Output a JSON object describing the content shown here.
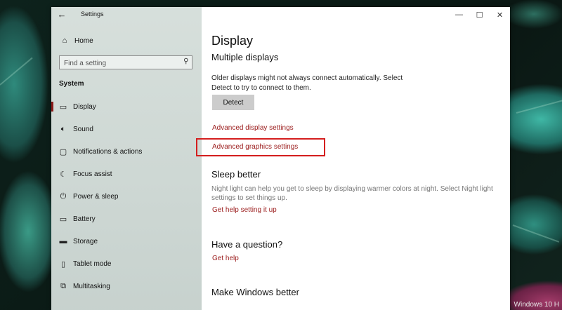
{
  "window": {
    "title": "Settings",
    "controls": {
      "minimize": "—",
      "maximize": "☐",
      "close": "✕"
    }
  },
  "sidebar": {
    "home_label": "Home",
    "search": {
      "placeholder": "Find a setting",
      "value": ""
    },
    "section_label": "System",
    "items": [
      {
        "label": "Display",
        "icon": "monitor-icon",
        "selected": true
      },
      {
        "label": "Sound",
        "icon": "speaker-icon"
      },
      {
        "label": "Notifications & actions",
        "icon": "notification-icon"
      },
      {
        "label": "Focus assist",
        "icon": "moon-icon"
      },
      {
        "label": "Power & sleep",
        "icon": "power-icon"
      },
      {
        "label": "Battery",
        "icon": "battery-icon"
      },
      {
        "label": "Storage",
        "icon": "storage-icon"
      },
      {
        "label": "Tablet mode",
        "icon": "tablet-icon"
      },
      {
        "label": "Multitasking",
        "icon": "multitasking-icon"
      }
    ]
  },
  "content": {
    "page_title": "Display",
    "multiple_displays": {
      "heading": "Multiple displays",
      "description_line1": "Older displays might not always connect automatically. Select",
      "description_line2": "Detect to try to connect to them.",
      "detect_button": "Detect"
    },
    "links": {
      "advanced_display": "Advanced display settings",
      "advanced_graphics": "Advanced graphics settings"
    },
    "sleep_better": {
      "heading": "Sleep better",
      "description_line1": "Night light can help you get to sleep by displaying warmer colors at night. Select Night light",
      "description_line2": "settings to set things up.",
      "link": "Get help setting it up"
    },
    "question": {
      "heading": "Have a question?",
      "link": "Get help"
    },
    "make_better": {
      "heading": "Make Windows better"
    }
  },
  "desktop": {
    "corner_text": "Windows 10 H"
  },
  "colors": {
    "accent": "#9b1c1c",
    "highlight": "#d41e1e"
  }
}
